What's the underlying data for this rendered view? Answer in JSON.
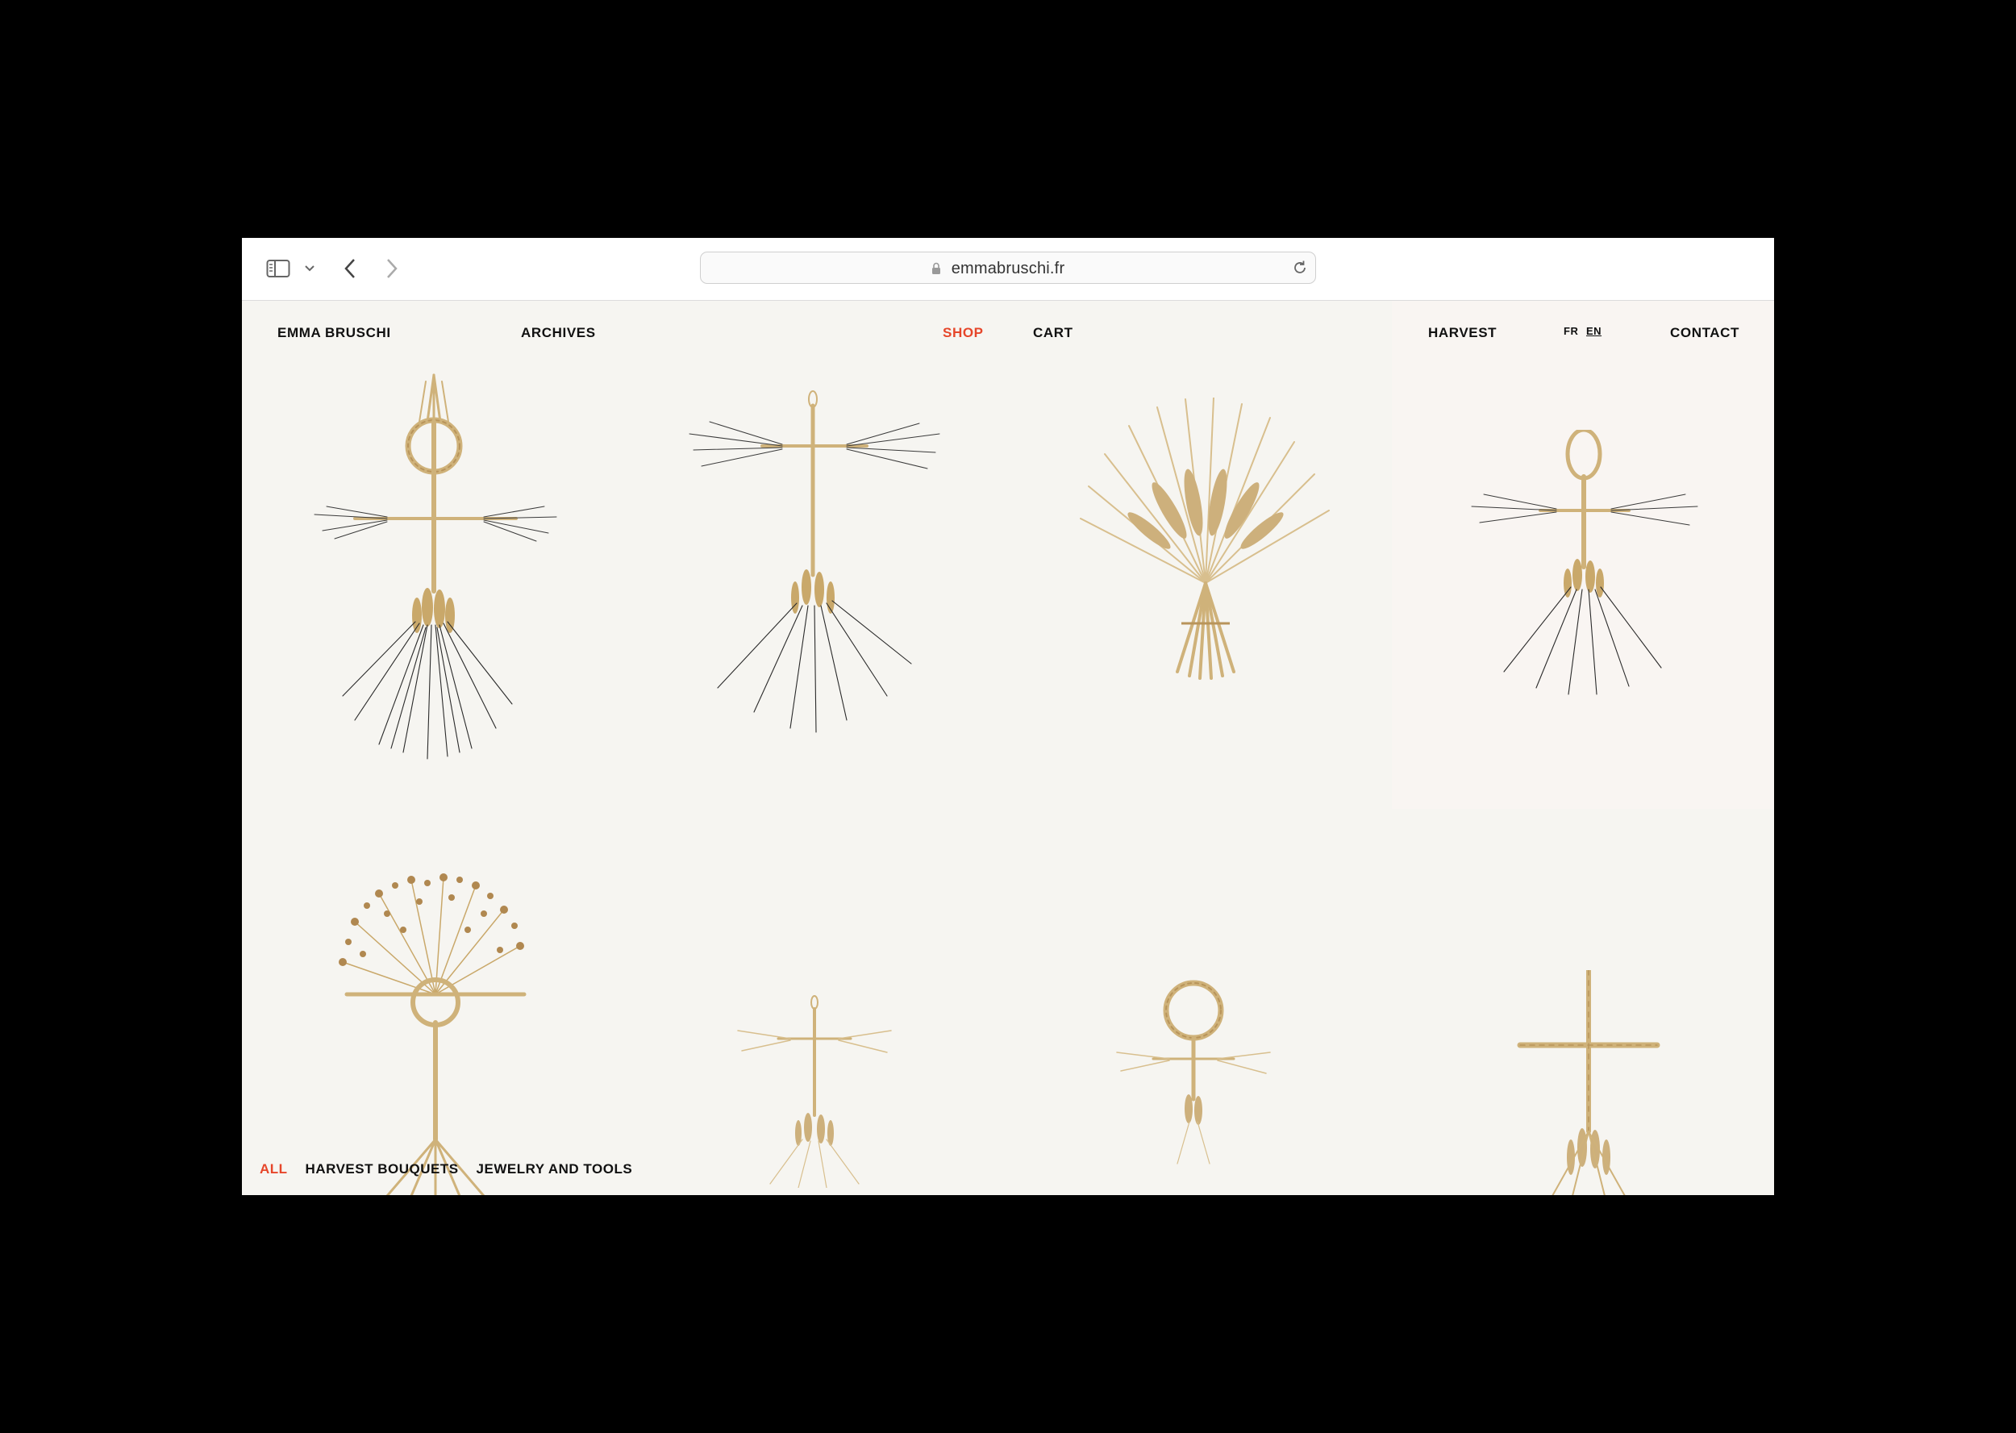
{
  "browser": {
    "url": "emmabruschi.fr"
  },
  "nav": {
    "brand": "EMMA BRUSCHI",
    "archives": "ARCHIVES",
    "shop": "SHOP",
    "cart": "CART",
    "harvest": "HARVEST",
    "lang_fr": "FR",
    "lang_en": "EN",
    "contact": "CONTACT"
  },
  "filters": {
    "all": "ALL",
    "bouquets": "HARVEST BOUQUETS",
    "jewelry": "JEWELRY AND TOOLS"
  },
  "colors": {
    "accent": "#e6462a",
    "background": "#f6f5f1",
    "straw": "#cfb27a"
  }
}
